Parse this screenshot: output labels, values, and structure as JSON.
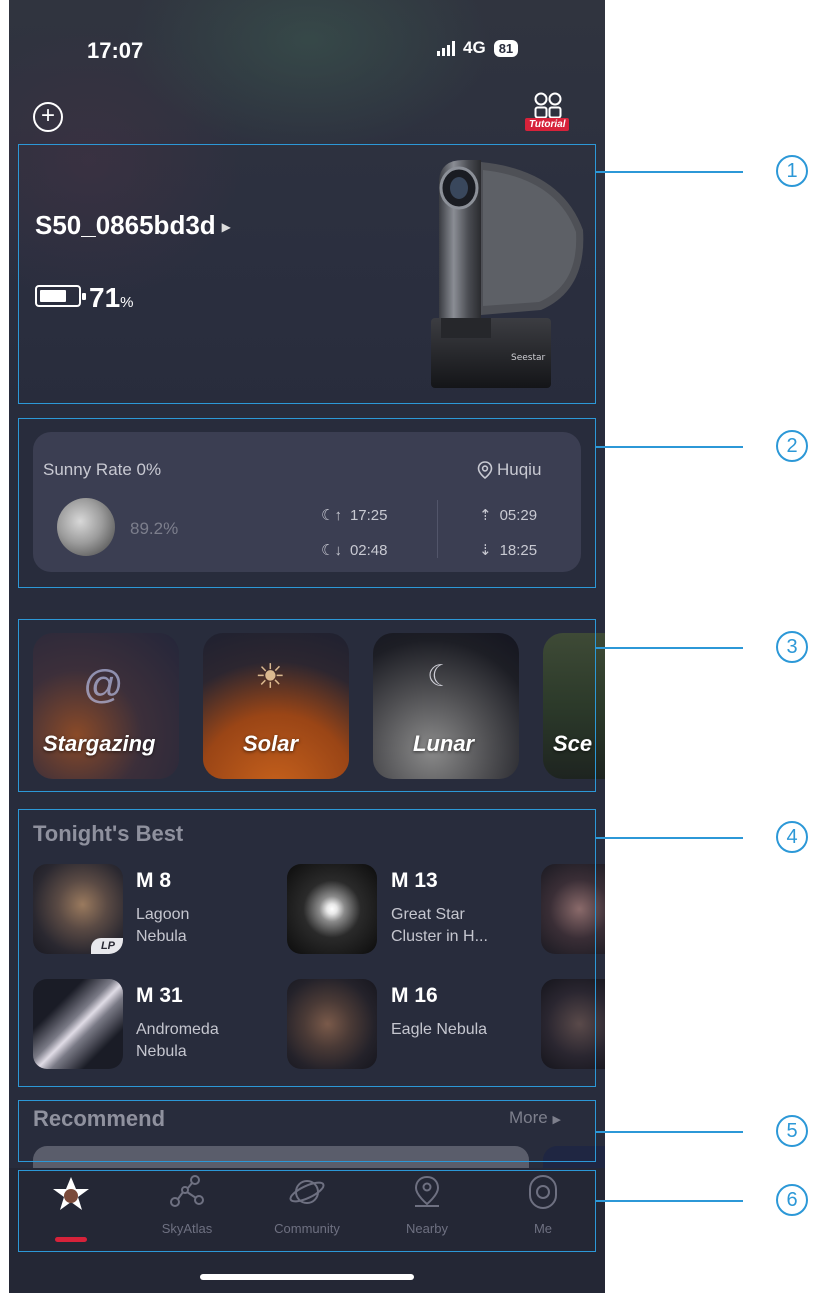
{
  "status_bar": {
    "time": "17:07",
    "network": "4G",
    "battery": "81"
  },
  "header": {
    "tutorial_label": "Tutorial"
  },
  "device": {
    "name": "S50_0865bd3d",
    "battery_value": "71",
    "battery_unit": "%",
    "battery_level": 0.71,
    "brand_label": "Seestar"
  },
  "weather": {
    "sunny_rate": "Sunny Rate 0%",
    "location": "Huqiu",
    "moon_illumination": "89.2%",
    "moonrise": "17:25",
    "moonset": "02:48",
    "sunrise": "05:29",
    "sunset": "18:25"
  },
  "categories": [
    {
      "label": "Stargazing"
    },
    {
      "label": "Solar"
    },
    {
      "label": "Lunar"
    },
    {
      "label": "Sce"
    }
  ],
  "tonights_best": {
    "title": "Tonight's Best",
    "lp_tag": "LP",
    "items": [
      {
        "code": "M 8",
        "name_line1": "Lagoon",
        "name_line2": "Nebula"
      },
      {
        "code": "M 13",
        "name_line1": "Great Star",
        "name_line2": "Cluster in H..."
      },
      {
        "code": "M 31",
        "name_line1": "Andromeda",
        "name_line2": "Nebula"
      },
      {
        "code": "M 16",
        "name_line1": "Eagle Nebula",
        "name_line2": ""
      }
    ]
  },
  "recommend": {
    "title": "Recommend",
    "more_label": "More"
  },
  "tabbar": {
    "items": [
      {
        "label": ""
      },
      {
        "label": "SkyAtlas"
      },
      {
        "label": "Community"
      },
      {
        "label": "Nearby"
      },
      {
        "label": "Me"
      }
    ]
  },
  "callouts": [
    "1",
    "2",
    "3",
    "4",
    "5",
    "6"
  ],
  "colors": {
    "accent_red": "#d7223a",
    "callout_blue": "#2c98d7",
    "background": "#282c3c"
  }
}
